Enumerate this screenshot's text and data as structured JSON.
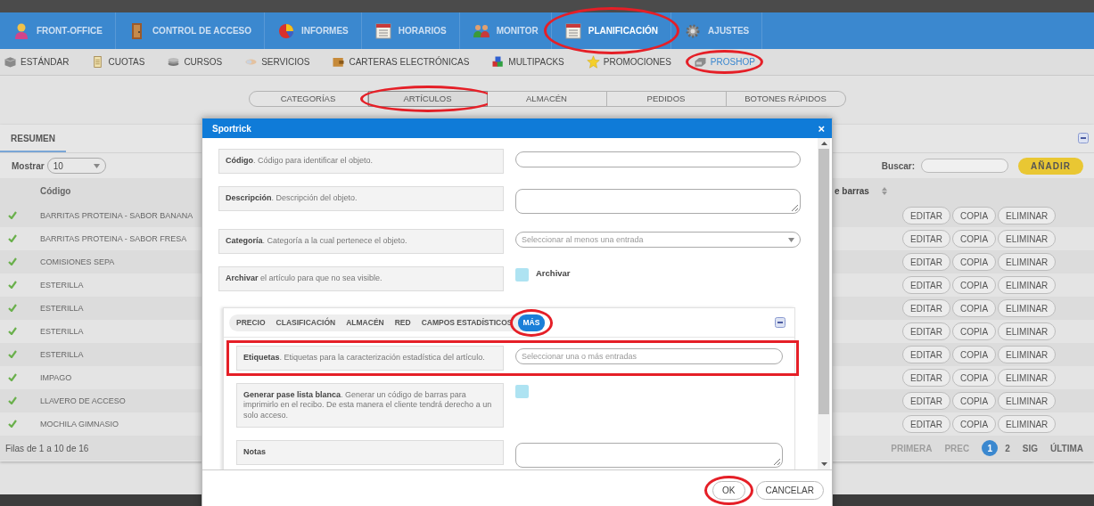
{
  "main_nav": [
    {
      "label": "FRONT-OFFICE",
      "selected": false,
      "highlighted": false
    },
    {
      "label": "CONTROL DE ACCESO",
      "selected": false,
      "highlighted": false
    },
    {
      "label": "INFORMES",
      "selected": false,
      "highlighted": false
    },
    {
      "label": "HORARIOS",
      "selected": false,
      "highlighted": false
    },
    {
      "label": "MONITOR",
      "selected": false,
      "highlighted": false
    },
    {
      "label": "PLANIFICACIÓN",
      "selected": true,
      "highlighted": true
    },
    {
      "label": "AJUSTES",
      "selected": false,
      "highlighted": false
    }
  ],
  "sub_nav": [
    {
      "label": "ESTÁNDAR",
      "selected": false,
      "highlighted": false
    },
    {
      "label": "CUOTAS",
      "selected": false,
      "highlighted": false
    },
    {
      "label": "CURSOS",
      "selected": false,
      "highlighted": false
    },
    {
      "label": "SERVICIOS",
      "selected": false,
      "highlighted": false
    },
    {
      "label": "CARTERAS ELECTRÓNICAS",
      "selected": false,
      "highlighted": false
    },
    {
      "label": "MULTIPACKS",
      "selected": false,
      "highlighted": false
    },
    {
      "label": "PROMOCIONES",
      "selected": false,
      "highlighted": false
    },
    {
      "label": "PROSHOP",
      "selected": true,
      "highlighted": true
    }
  ],
  "section_tabs": [
    {
      "label": "CATEGORÍAS",
      "selected": false,
      "highlighted": false
    },
    {
      "label": "ARTÍCULOS",
      "selected": true,
      "highlighted": true
    },
    {
      "label": "ALMACÉN",
      "selected": false,
      "highlighted": false
    },
    {
      "label": "PEDIDOS",
      "selected": false,
      "highlighted": false
    },
    {
      "label": "BOTONES RÁPIDOS",
      "selected": false,
      "highlighted": false
    }
  ],
  "panel": {
    "title": "RESUMEN",
    "show_label": "Mostrar",
    "page_size": "10",
    "search_label": "Buscar:",
    "add_button": "AÑADIR",
    "columns": [
      "Código",
      "e barras"
    ],
    "rows": [
      {
        "active": true,
        "code": "BARRITAS PROTEINA - SABOR BANANA",
        "actions": [
          "EDITAR",
          "COPIA",
          "ELIMINAR"
        ]
      },
      {
        "active": true,
        "code": "BARRITAS PROTEINA - SABOR FRESA",
        "actions": [
          "EDITAR",
          "COPIA",
          "ELIMINAR"
        ]
      },
      {
        "active": true,
        "code": "COMISIONES SEPA",
        "actions": [
          "EDITAR",
          "COPIA",
          "ELIMINAR"
        ]
      },
      {
        "active": true,
        "code": "ESTERILLA",
        "actions": [
          "EDITAR",
          "COPIA",
          "ELIMINAR"
        ]
      },
      {
        "active": true,
        "code": "ESTERILLA",
        "actions": [
          "EDITAR",
          "COPIA",
          "ELIMINAR"
        ]
      },
      {
        "active": true,
        "code": "ESTERILLA",
        "actions": [
          "EDITAR",
          "COPIA",
          "ELIMINAR"
        ]
      },
      {
        "active": true,
        "code": "ESTERILLA",
        "actions": [
          "EDITAR",
          "COPIA",
          "ELIMINAR"
        ]
      },
      {
        "active": true,
        "code": "IMPAGO",
        "actions": [
          "EDITAR",
          "COPIA",
          "ELIMINAR"
        ]
      },
      {
        "active": true,
        "code": "LLAVERO DE ACCESO",
        "actions": [
          "EDITAR",
          "COPIA",
          "ELIMINAR"
        ]
      },
      {
        "active": true,
        "code": "MOCHILA GIMNASIO",
        "actions": [
          "EDITAR",
          "COPIA",
          "ELIMINAR"
        ]
      }
    ],
    "info": "Filas de 1 a 10 de 16",
    "pagination": [
      {
        "label": "PRIMERA",
        "selected": false,
        "disabled": true
      },
      {
        "label": "PREC",
        "selected": false,
        "disabled": true
      },
      {
        "label": "1",
        "selected": true,
        "disabled": false
      },
      {
        "label": "2",
        "selected": false,
        "disabled": false
      },
      {
        "label": "SIG",
        "selected": false,
        "disabled": false
      },
      {
        "label": "ÚLTIMA",
        "selected": false,
        "disabled": false
      }
    ]
  },
  "modal": {
    "title": "Sportrick",
    "close": "×",
    "fields": [
      {
        "kind": "text",
        "title": "Código",
        "description": ". Código para identificar el objeto.",
        "highlighted": false
      },
      {
        "kind": "textarea",
        "title": "Descripción",
        "description": ". Descripción del objeto.",
        "highlighted": false
      },
      {
        "kind": "select",
        "title": "Categoría",
        "description": ". Categoría a la cual pertenece el objeto.",
        "placeholder": "Seleccionar al menos una entrada",
        "highlighted": false
      },
      {
        "kind": "checkbox",
        "title": "Archivar",
        "description": " el artículo para que no sea visible.",
        "checkbox_label": "Archivar",
        "checked": false,
        "highlighted": false
      }
    ],
    "tabs": [
      {
        "label": "PRECIO",
        "selected": false,
        "highlighted": false
      },
      {
        "label": "CLASIFICACIÓN",
        "selected": false,
        "highlighted": false
      },
      {
        "label": "ALMACÉN",
        "selected": false,
        "highlighted": false
      },
      {
        "label": "RED",
        "selected": false,
        "highlighted": false
      },
      {
        "label": "CAMPOS ESTADÍSTICOS",
        "selected": false,
        "highlighted": false
      },
      {
        "label": "MÁS",
        "selected": true,
        "highlighted": true
      }
    ],
    "tab_fields": [
      {
        "kind": "tags",
        "title": "Etiquetas",
        "description": ". Etiquetas para la caracterización estadística del artículo.",
        "placeholder": "Seleccionar una o más entradas",
        "highlighted": true
      },
      {
        "kind": "checkbox",
        "title": "Generar pase lista blanca",
        "description": ". Generar un código de barras para imprimirlo en el recibo. De esta manera el cliente tendrá derecho a un solo acceso.",
        "checked": false,
        "highlighted": false
      },
      {
        "kind": "textarea",
        "title": "Notas",
        "highlighted": false
      }
    ],
    "buttons": [
      {
        "label": "OK",
        "highlighted": true
      },
      {
        "label": "CANCELAR",
        "highlighted": false
      }
    ]
  }
}
